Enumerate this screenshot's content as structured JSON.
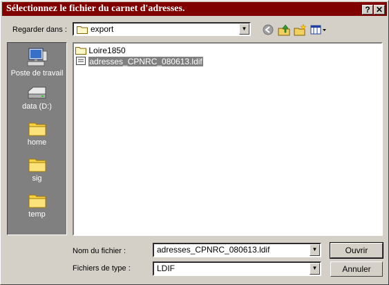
{
  "title": "Sélectionnez le fichier du carnet d'adresses.",
  "lookin": {
    "label": "Regarder dans :",
    "value": "export"
  },
  "sidebar": {
    "items": [
      {
        "label": "Poste de travail",
        "icon": "computer-icon"
      },
      {
        "label": "data (D:)",
        "icon": "drive-icon"
      },
      {
        "label": "home",
        "icon": "folder-icon"
      },
      {
        "label": "sig",
        "icon": "folder-icon"
      },
      {
        "label": "temp",
        "icon": "folder-icon"
      }
    ]
  },
  "files": [
    {
      "name": "Loire1850",
      "type": "folder"
    },
    {
      "name": "adresses_CPNRC_080613.ldif",
      "type": "file",
      "selected": true
    }
  ],
  "filename": {
    "label": "Nom du fichier :",
    "value": "adresses_CPNRC_080613.ldif"
  },
  "filetype": {
    "label": "Fichiers de type :",
    "value": "LDIF"
  },
  "buttons": {
    "open": "Ouvrir",
    "cancel": "Annuler"
  },
  "colors": {
    "titlebar": "#800000",
    "face": "#d4d0c8",
    "sidebar": "#808080",
    "selection": "#808080"
  }
}
